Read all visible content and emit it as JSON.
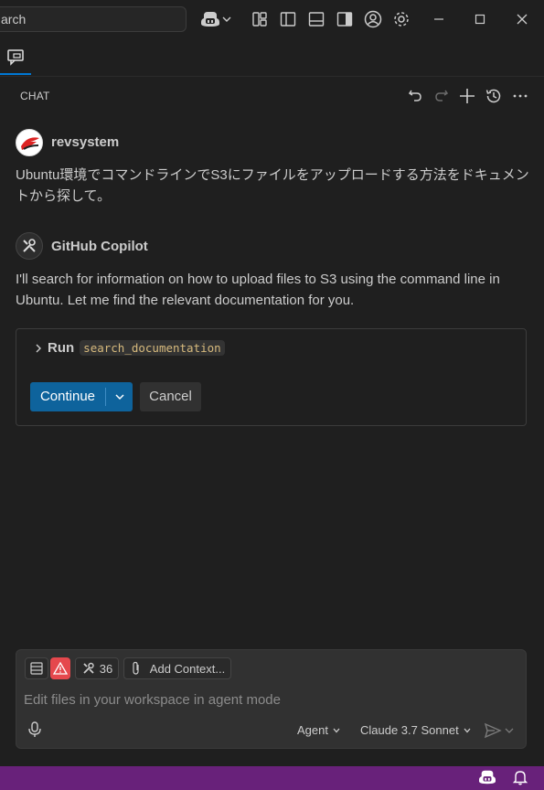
{
  "titlebar": {
    "search_text": "arch",
    "icons": [
      "copilot-icon",
      "chevron-down-icon",
      "customize-layout-icon",
      "toggle-primary-sidebar-icon",
      "toggle-panel-icon",
      "toggle-secondary-sidebar-icon",
      "accounts-icon",
      "settings-gear-icon",
      "minimize-icon",
      "maximize-icon",
      "close-icon"
    ]
  },
  "tabs": [
    {
      "icon": "chat-icon",
      "active": true
    }
  ],
  "panel": {
    "title": "CHAT",
    "actions": [
      "undo-icon",
      "redo-icon",
      "new-chat-icon",
      "history-icon",
      "more-icon"
    ]
  },
  "messages": [
    {
      "author": "revsystem",
      "text": "Ubuntu環境でコマンドラインでS3にファイルをアップロードする方法をドキュメントから探して。"
    },
    {
      "author": "GitHub Copilot",
      "text": "I'll search for information on how to upload files to S3 using the command line in Ubuntu. Let me find the relevant documentation for you.",
      "tool_call": {
        "run_label": "Run",
        "tool_name": "search_documentation",
        "continue_label": "Continue",
        "cancel_label": "Cancel"
      }
    }
  ],
  "input": {
    "tools_count": "36",
    "add_context_label": "Add Context...",
    "placeholder": "Edit files in your workspace in agent mode",
    "mode": "Agent",
    "model": "Claude 3.7 Sonnet"
  },
  "colors": {
    "accent": "#0e639c",
    "statusbar": "#68217a",
    "warning": "#e5484d"
  }
}
